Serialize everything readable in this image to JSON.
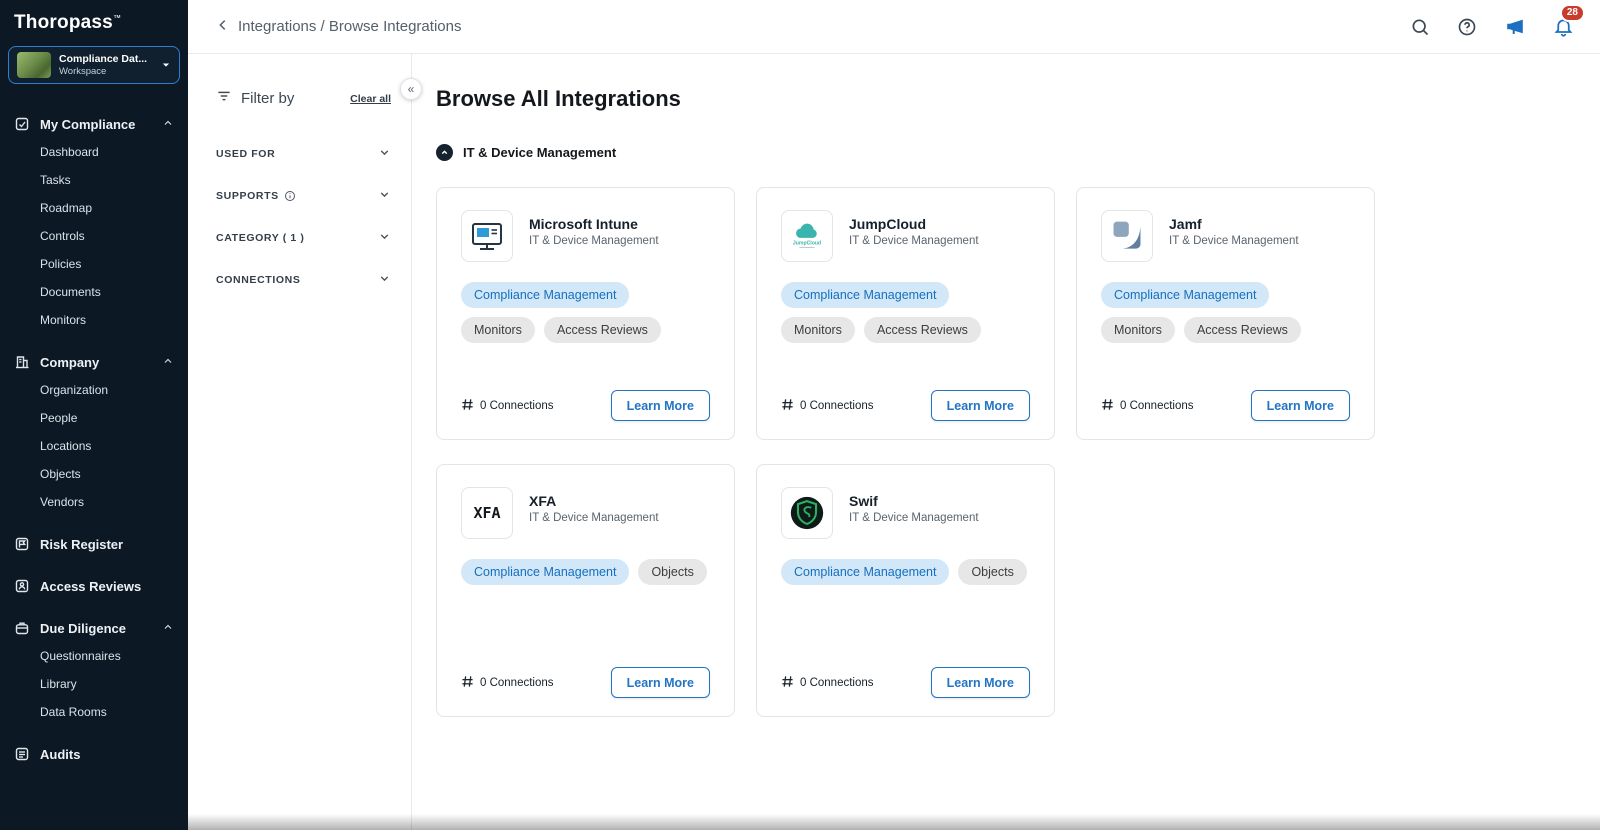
{
  "colors": {
    "sidebar_bg": "#0c1925",
    "accent_blue": "#2375c3",
    "pill_blue_bg": "#d2e7f8",
    "pill_blue_text": "#1570bf",
    "pill_gray_bg": "#e7e7e7",
    "badge_red": "#c93b2b"
  },
  "brand": {
    "name": "Thoropass",
    "tm": "™"
  },
  "workspace": {
    "name": "Compliance Dat...",
    "subtitle": "Workspace"
  },
  "sidebar": {
    "groups": [
      {
        "label": "My Compliance",
        "items": [
          "Dashboard",
          "Tasks",
          "Roadmap",
          "Controls",
          "Policies",
          "Documents",
          "Monitors"
        ]
      },
      {
        "label": "Company",
        "items": [
          "Organization",
          "People",
          "Locations",
          "Objects",
          "Vendors"
        ]
      },
      {
        "label": "Risk Register",
        "items": []
      },
      {
        "label": "Access Reviews",
        "items": []
      },
      {
        "label": "Due Diligence",
        "items": [
          "Questionnaires",
          "Library",
          "Data Rooms"
        ]
      },
      {
        "label": "Audits",
        "items": []
      }
    ]
  },
  "header": {
    "breadcrumb": "Integrations / Browse Integrations",
    "notification_count": "28"
  },
  "filters": {
    "title": "Filter by",
    "clear_all": "Clear all",
    "sections": [
      "USED FOR",
      "SUPPORTS",
      "CATEGORY ( 1 )",
      "CONNECTIONS"
    ]
  },
  "main": {
    "title": "Browse All Integrations",
    "section_label": "IT & Device Management",
    "cards": [
      {
        "name": "Microsoft Intune",
        "subtitle": "IT & Device Management",
        "tags": [
          "Compliance Management",
          "Monitors",
          "Access Reviews"
        ],
        "connections": "0 Connections",
        "cta": "Learn More"
      },
      {
        "name": "JumpCloud",
        "subtitle": "IT & Device Management",
        "tags": [
          "Compliance Management",
          "Monitors",
          "Access Reviews"
        ],
        "connections": "0 Connections",
        "cta": "Learn More"
      },
      {
        "name": "Jamf",
        "subtitle": "IT & Device Management",
        "tags": [
          "Compliance Management",
          "Monitors",
          "Access Reviews"
        ],
        "connections": "0 Connections",
        "cta": "Learn More"
      },
      {
        "name": "XFA",
        "subtitle": "IT & Device Management",
        "tags": [
          "Compliance Management",
          "Objects"
        ],
        "connections": "0 Connections",
        "cta": "Learn More"
      },
      {
        "name": "Swif",
        "subtitle": "IT & Device Management",
        "tags": [
          "Compliance Management",
          "Objects"
        ],
        "connections": "0 Connections",
        "cta": "Learn More"
      }
    ]
  }
}
